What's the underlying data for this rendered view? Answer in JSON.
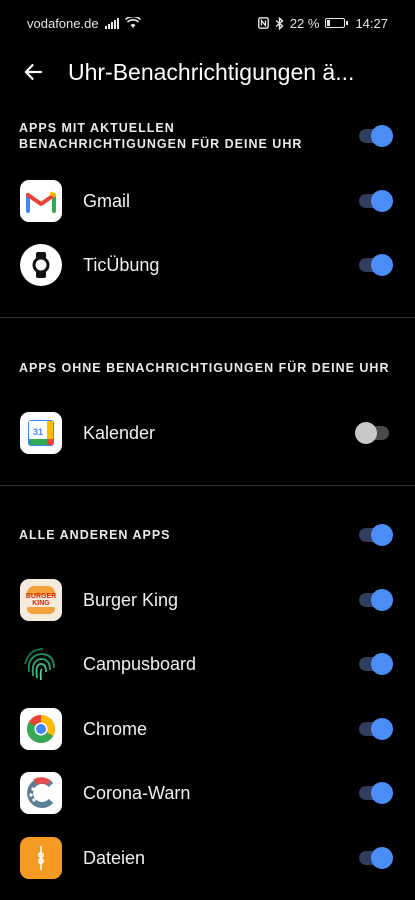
{
  "status_bar": {
    "carrier": "vodafone.de",
    "battery_text": "22 %",
    "battery_level": 0.22,
    "time": "14:27"
  },
  "app_bar": {
    "title": "Uhr-Benachrichtigungen ä..."
  },
  "sections": {
    "active": {
      "label": "APPS MIT AKTUELLEN BENACHRICHTIGUNGEN FÜR DEINE UHR",
      "toggle_on": true,
      "apps": [
        {
          "name": "Gmail",
          "icon": "gmail-icon",
          "on": true
        },
        {
          "name": "TicÜbung",
          "icon": "watch-icon",
          "on": true
        }
      ]
    },
    "without": {
      "label": "APPS OHNE BENACHRICHTIGUNGEN FÜR DEINE UHR",
      "apps": [
        {
          "name": "Kalender",
          "icon": "calendar-icon",
          "calendar_day": "31",
          "on": false
        }
      ]
    },
    "others": {
      "label": "ALLE ANDEREN APPS",
      "toggle_on": true,
      "apps": [
        {
          "name": "Burger King",
          "icon": "burger-king-icon",
          "icon_text": "BURGER KING",
          "on": true
        },
        {
          "name": "Campusboard",
          "icon": "fingerprint-icon",
          "on": true
        },
        {
          "name": "Chrome",
          "icon": "chrome-icon",
          "on": true
        },
        {
          "name": "Corona-Warn",
          "icon": "corona-warn-icon",
          "on": true
        },
        {
          "name": "Dateien",
          "icon": "files-icon",
          "on": true
        }
      ]
    }
  },
  "colors": {
    "toggle_on_thumb": "#4c8df5",
    "toggle_on_track": "#2f3e5e",
    "toggle_off_thumb": "#c8c8c8",
    "background": "#000000"
  }
}
